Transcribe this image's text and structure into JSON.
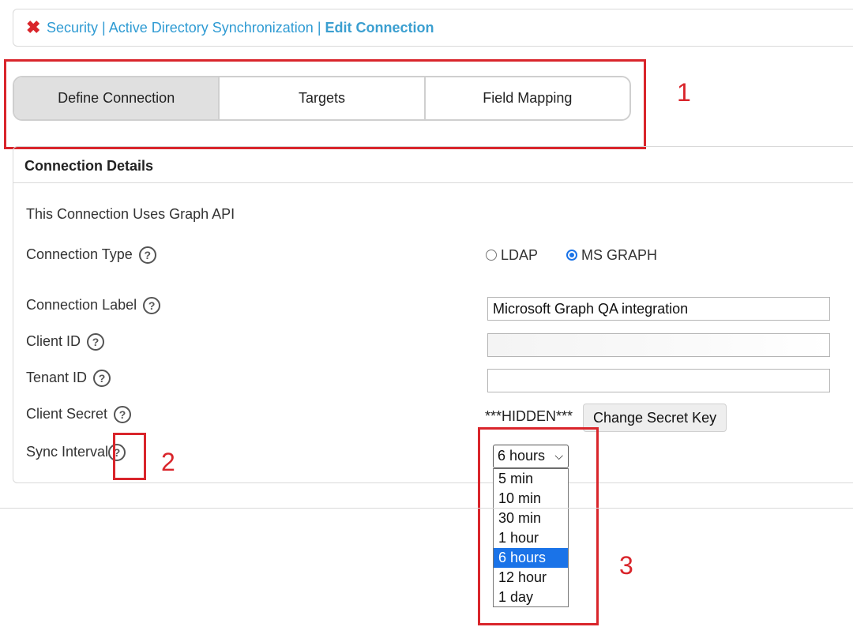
{
  "breadcrumb": {
    "part1": "Security",
    "sep1": " | ",
    "part2": "Active Directory Synchronization",
    "sep2": " | ",
    "current": "Edit Connection"
  },
  "tabs": [
    {
      "label": "Define Connection",
      "active": true
    },
    {
      "label": "Targets",
      "active": false
    },
    {
      "label": "Field Mapping",
      "active": false
    }
  ],
  "panel": {
    "title": "Connection Details",
    "uses_text": "This Connection Uses Graph API",
    "connection_type": {
      "label": "Connection Type",
      "options": [
        {
          "label": "LDAP",
          "selected": false
        },
        {
          "label": "MS GRAPH",
          "selected": true
        }
      ]
    },
    "connection_label": {
      "label": "Connection Label",
      "value": "Microsoft Graph QA integration"
    },
    "client_id": {
      "label": "Client ID",
      "value": ""
    },
    "tenant_id": {
      "label": "Tenant ID",
      "value": ""
    },
    "client_secret": {
      "label": "Client Secret",
      "value": "***HIDDEN***",
      "button": "Change Secret Key"
    },
    "sync_interval": {
      "label": "Sync Interval",
      "selected": "6 hours",
      "options": [
        "5 min",
        "10 min",
        "30 min",
        "1 hour",
        "6 hours",
        "12 hour",
        "1 day"
      ]
    }
  },
  "annotations": {
    "n1": "1",
    "n2": "2",
    "n3": "3"
  },
  "icons": {
    "close": "x-icon",
    "help": "question-circle-icon",
    "chevron": "chevron-down-icon"
  },
  "colors": {
    "link": "#2f9bd3",
    "annotation": "#d9252b",
    "selected": "#1a73e8"
  }
}
